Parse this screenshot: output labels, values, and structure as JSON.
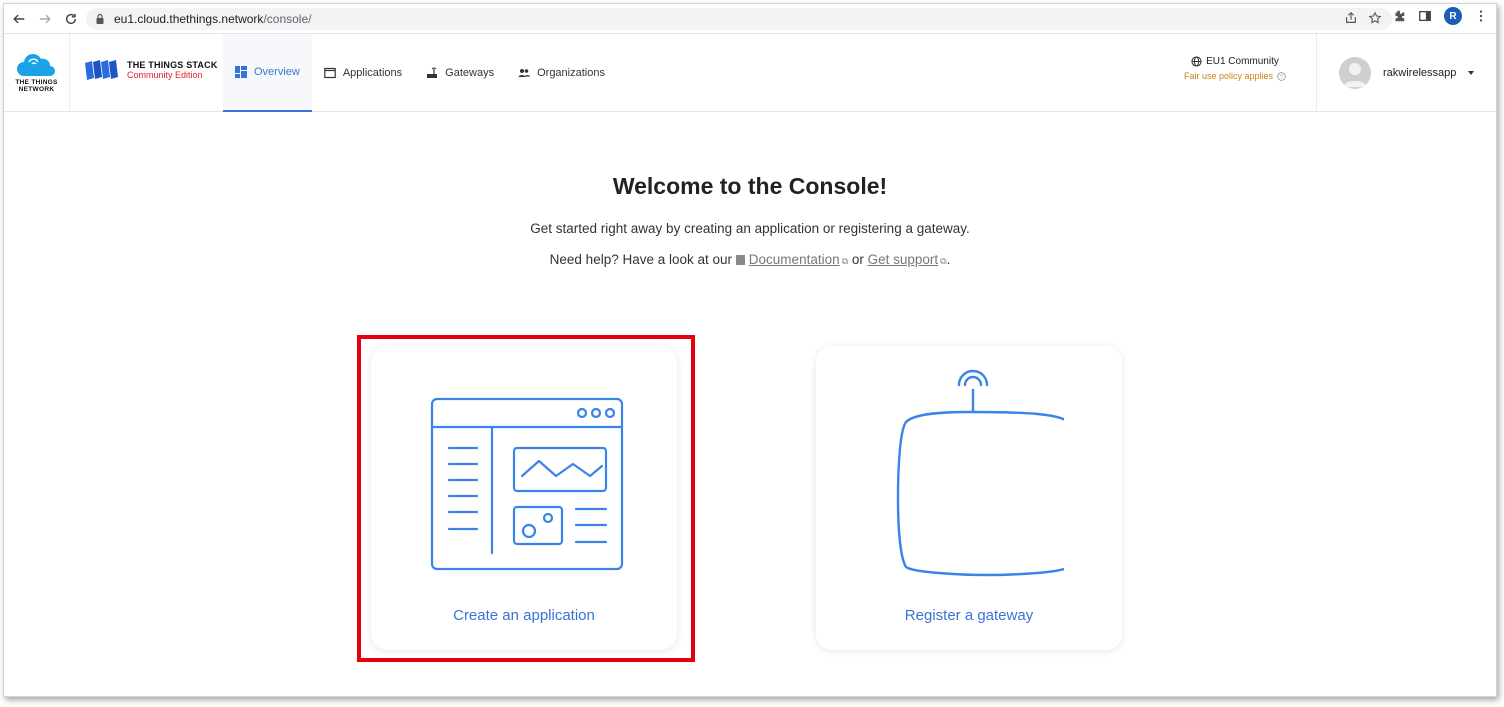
{
  "browser": {
    "url_host": "eu1.cloud.thethings.network",
    "url_path": "/console/",
    "profile_initial": "R"
  },
  "header": {
    "ttn_logo_text_line1": "THE THINGS",
    "ttn_logo_text_line2": "NETWORK",
    "stack_title": "THE THINGS STACK",
    "stack_subtitle": "Community Edition",
    "nav": [
      {
        "label": "Overview",
        "icon": "dashboard-icon",
        "active": true
      },
      {
        "label": "Applications",
        "icon": "window-icon"
      },
      {
        "label": "Gateways",
        "icon": "router-icon"
      },
      {
        "label": "Organizations",
        "icon": "people-icon"
      }
    ],
    "cluster": "EU1 Community",
    "fair_use": "Fair use policy applies",
    "username": "rakwirelessapp"
  },
  "main": {
    "title": "Welcome to the Console!",
    "intro": "Get started right away by creating an application or registering a gateway.",
    "help_prefix": "Need help? Have a look at our",
    "doc_link": "Documentation",
    "or": "or",
    "support_link": "Get support",
    "period": "."
  },
  "cards": {
    "application": "Create an application",
    "gateway": "Register a gateway"
  },
  "colors": {
    "accent": "#3a73d6",
    "highlight": "#e3000f",
    "fair_use": "#c8821c"
  }
}
